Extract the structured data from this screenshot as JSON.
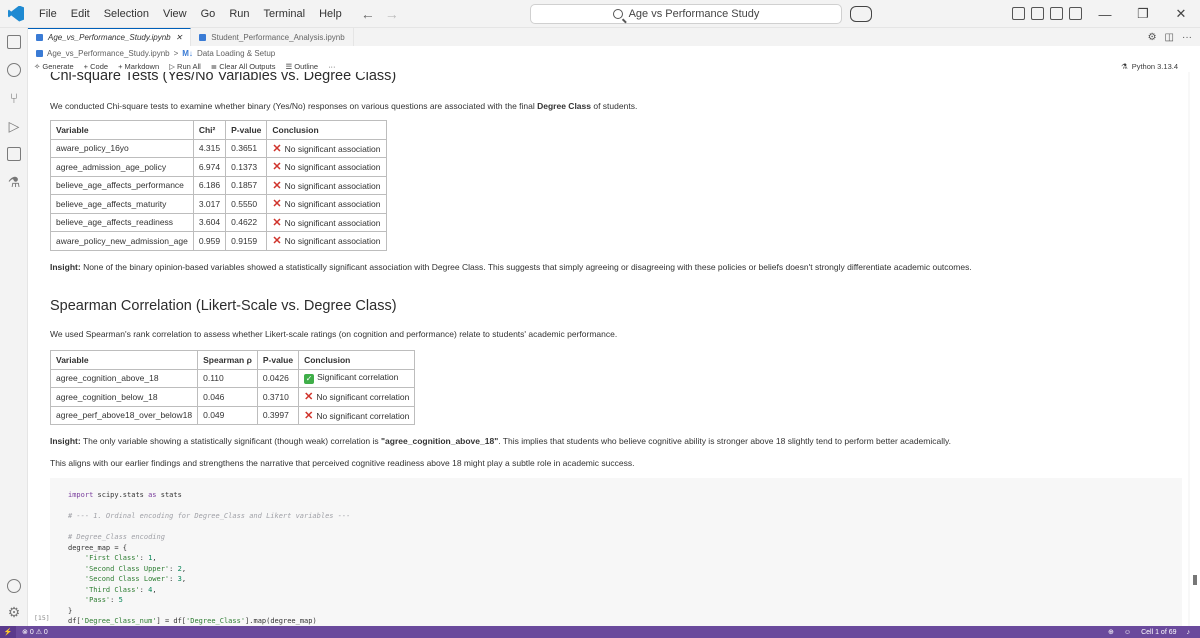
{
  "titlebar": {
    "menu": [
      "File",
      "Edit",
      "Selection",
      "View",
      "Go",
      "Run",
      "Terminal",
      "Help"
    ],
    "search_text": "Age vs Performance Study"
  },
  "tabs": [
    {
      "label": "Age_vs_Performance_Study.ipynb",
      "active": true
    },
    {
      "label": "Student_Performance_Analysis.ipynb",
      "active": false
    }
  ],
  "breadcrumb": {
    "file": "Age_vs_Performance_Study.ipynb",
    "sep": ">",
    "md_tag": "M↓",
    "section": "Data Loading & Setup"
  },
  "toolbar": {
    "generate": "Generate",
    "code": "Code",
    "markdown": "Markdown",
    "run_all": "Run All",
    "clear_outputs": "Clear All Outputs",
    "outline": "Outline",
    "more": "···",
    "kernel": "Python 3.13.4"
  },
  "chi": {
    "title": "Chi-square Tests (Yes/No Variables vs. Degree Class)",
    "intro_pre": "We conducted Chi-square tests to examine whether binary (Yes/No) responses on various questions are associated with the final ",
    "intro_bold": "Degree Class",
    "intro_post": " of students.",
    "headers": [
      "Variable",
      "Chi²",
      "P-value",
      "Conclusion"
    ],
    "rows": [
      [
        "aware_policy_16yo",
        "4.315",
        "0.3651",
        "No significant association"
      ],
      [
        "agree_admission_age_policy",
        "6.974",
        "0.1373",
        "No significant association"
      ],
      [
        "believe_age_affects_performance",
        "6.186",
        "0.1857",
        "No significant association"
      ],
      [
        "believe_age_affects_maturity",
        "3.017",
        "0.5550",
        "No significant association"
      ],
      [
        "believe_age_affects_readiness",
        "3.604",
        "0.4622",
        "No significant association"
      ],
      [
        "aware_policy_new_admission_age",
        "0.959",
        "0.9159",
        "No significant association"
      ]
    ],
    "insight_label": "Insight:",
    "insight_text": " None of the binary opinion-based variables showed a statistically significant association with Degree Class. This suggests that simply agreeing or disagreeing with these policies or beliefs doesn't strongly differentiate academic outcomes."
  },
  "spearman": {
    "title": "Spearman Correlation (Likert-Scale vs. Degree Class)",
    "intro": "We used Spearman's rank correlation to assess whether Likert-scale ratings (on cognition and performance) relate to students' academic performance.",
    "headers": [
      "Variable",
      "Spearman ρ",
      "P-value",
      "Conclusion"
    ],
    "rows": [
      [
        "agree_cognition_above_18",
        "0.110",
        "0.0426",
        "Significant correlation",
        true
      ],
      [
        "agree_cognition_below_18",
        "0.046",
        "0.3710",
        "No significant correlation",
        false
      ],
      [
        "agree_perf_above18_over_below18",
        "0.049",
        "0.3997",
        "No significant correlation",
        false
      ]
    ],
    "insight_label": "Insight:",
    "insight_pre": " The only variable showing a statistically significant (though weak) correlation is ",
    "insight_bold": "\"agree_cognition_above_18\"",
    "insight_post": ". This implies that students who believe cognitive ability is stronger above 18 slightly tend to perform better academically.",
    "insight2": "This aligns with our earlier findings and strengthens the narrative that perceived cognitive readiness above 18 might play a subtle role in academic success."
  },
  "code": {
    "exec_count": "[15]",
    "l1_kw": "import",
    "l1_rest": " scipy.stats ",
    "l1_as": "as",
    "l1_end": " stats",
    "l2": "# --- 1. Ordinal encoding for Degree_Class and Likert variables ---",
    "l3": "# Degree_Class encoding",
    "l4": "degree_map = {",
    "l5_key": "'First Class'",
    "l5_val": "1",
    "l6_key": "'Second Class Upper'",
    "l6_val": "2",
    "l7_key": "'Second Class Lower'",
    "l7_val": "3",
    "l8_key": "'Third Class'",
    "l8_val": "4",
    "l9_key": "'Pass'",
    "l9_val": "5",
    "l10": "}",
    "l11_pre": "df[",
    "l11_str1": "'Degree_Class_num'",
    "l11_mid": "] = df[",
    "l11_str2": "'Degree_Class'",
    "l11_end": "].map(degree_map)"
  },
  "statusbar": {
    "errors": "0",
    "warnings": "0",
    "cell": "Cell 1 of 69"
  }
}
